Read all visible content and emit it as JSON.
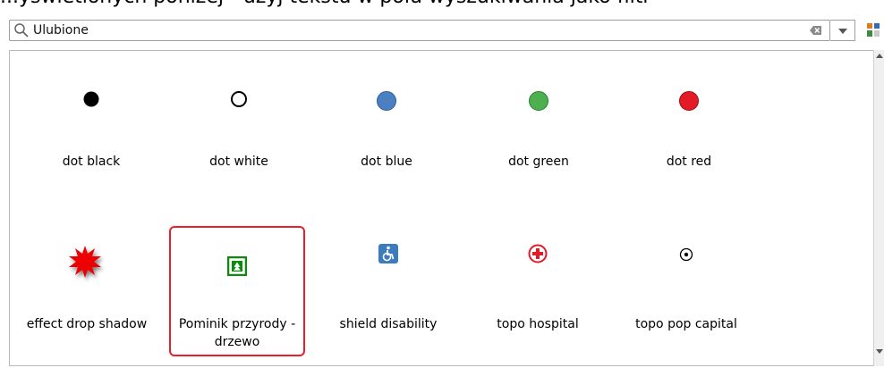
{
  "top_text": "...yswietlonych poniżej - użyj tekstu w polu wyszukiwania jako filtr",
  "search": {
    "value": "Ulubione"
  },
  "symbols": [
    {
      "label": "dot  black",
      "icon": "black-dot",
      "color": "#000000"
    },
    {
      "label": "dot  white",
      "icon": "white-dot",
      "color": "#ffffff"
    },
    {
      "label": "dot blue",
      "icon": "blue-dot",
      "color": "#4a7fc1"
    },
    {
      "label": "dot green",
      "icon": "green-dot",
      "color": "#4caf50"
    },
    {
      "label": "dot red",
      "icon": "red-dot",
      "color": "#e21b26"
    },
    {
      "label": "effect drop shadow",
      "icon": "red-star-burst",
      "color": "#ee0000"
    },
    {
      "label": "Pominik przyrody - drzewo",
      "icon": "tree-sign",
      "color": "#0b8a0b",
      "selected": true
    },
    {
      "label": "shield disability",
      "icon": "wheelchair",
      "color": "#3d7bbf"
    },
    {
      "label": "topo hospital",
      "icon": "hospital-cross",
      "color": "#e21b26"
    },
    {
      "label": "topo pop capital",
      "icon": "capital-dot",
      "color": "#000000"
    }
  ]
}
